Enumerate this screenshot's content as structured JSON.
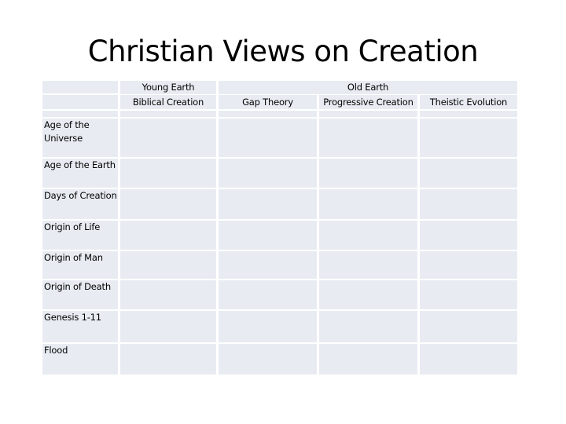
{
  "slide": {
    "title": "Christian Views on Creation"
  },
  "table": {
    "header_top": {
      "young_earth": "Young Earth",
      "old_earth": "Old Earth"
    },
    "columns": [
      "",
      "Biblical Creation",
      "Gap Theory",
      "Progressive Creation",
      "Theistic Evolution"
    ],
    "rows": [
      {
        "label": "Age of the Universe",
        "values": [
          "",
          "",
          "",
          ""
        ]
      },
      {
        "label": "Age of the Earth",
        "values": [
          "",
          "",
          "",
          ""
        ]
      },
      {
        "label": "Days of Creation",
        "values": [
          "",
          "",
          "",
          ""
        ]
      },
      {
        "label": "Origin of Life",
        "values": [
          "",
          "",
          "",
          ""
        ]
      },
      {
        "label": "Origin of Man",
        "values": [
          "",
          "",
          "",
          ""
        ]
      },
      {
        "label": "Origin of Death",
        "values": [
          "",
          "",
          "",
          ""
        ]
      },
      {
        "label": "Genesis 1-11",
        "values": [
          "",
          "",
          "",
          ""
        ]
      },
      {
        "label": "Flood",
        "values": [
          "",
          "",
          "",
          ""
        ]
      }
    ],
    "cell_color": "#e8ecf2"
  }
}
